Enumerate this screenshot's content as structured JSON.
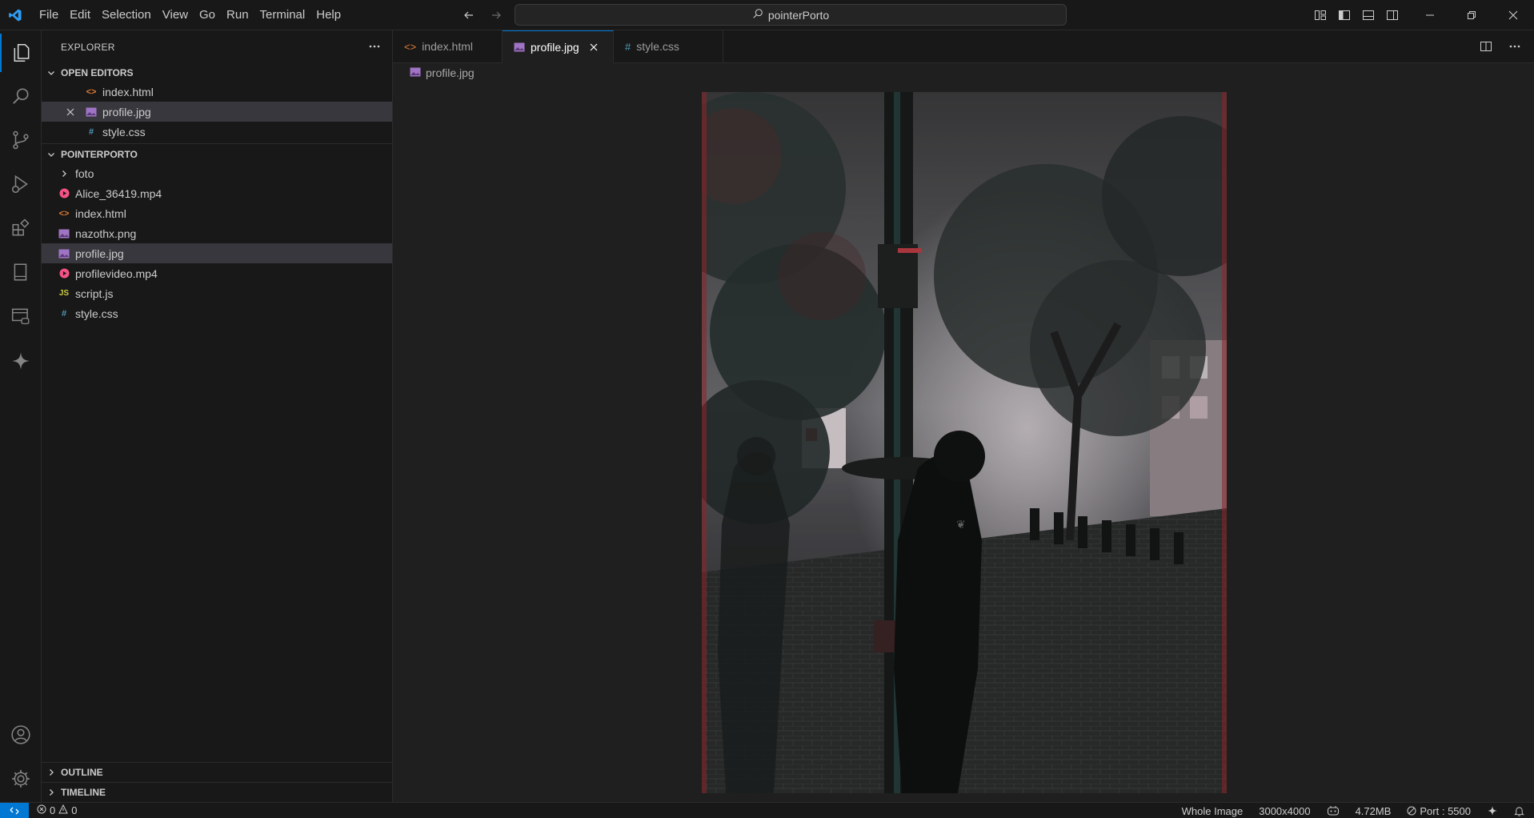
{
  "titlebar": {
    "menu": [
      "File",
      "Edit",
      "Selection",
      "View",
      "Go",
      "Run",
      "Terminal",
      "Help"
    ],
    "search_text": "pointerPorto"
  },
  "explorer": {
    "title": "EXPLORER",
    "open_editors": {
      "title": "OPEN EDITORS",
      "items": [
        {
          "label": "index.html",
          "icon": "html-file-icon"
        },
        {
          "label": "profile.jpg",
          "icon": "image-file-icon"
        },
        {
          "label": "style.css",
          "icon": "css-file-icon"
        }
      ]
    },
    "project": {
      "title": "POINTERPORTO",
      "items": [
        {
          "label": "foto",
          "icon": "folder-chevron-icon"
        },
        {
          "label": "Alice_36419.mp4",
          "icon": "video-file-icon"
        },
        {
          "label": "index.html",
          "icon": "html-file-icon"
        },
        {
          "label": "nazothx.png",
          "icon": "image-file-icon"
        },
        {
          "label": "profile.jpg",
          "icon": "image-file-icon"
        },
        {
          "label": "profilevideo.mp4",
          "icon": "video-file-icon"
        },
        {
          "label": "script.js",
          "icon": "js-file-icon"
        },
        {
          "label": "style.css",
          "icon": "css-file-icon"
        }
      ]
    },
    "outline": "OUTLINE",
    "timeline": "TIMELINE"
  },
  "tabs": [
    {
      "label": "index.html",
      "icon": "html-file-icon",
      "active": false
    },
    {
      "label": "profile.jpg",
      "icon": "image-file-icon",
      "active": true
    },
    {
      "label": "style.css",
      "icon": "css-file-icon",
      "active": false
    }
  ],
  "breadcrumb": "profile.jpg",
  "statusbar": {
    "errors": "0",
    "warnings": "0",
    "zoom_mode": "Whole Image",
    "dimensions": "3000x4000",
    "file_size": "4.72MB",
    "port": "Port : 5500"
  },
  "colors": {
    "accent": "#0078d4",
    "html": "#e37933",
    "css": "#519aba",
    "js": "#cbcb41",
    "image": "#a074c4",
    "video": "#f55385"
  }
}
